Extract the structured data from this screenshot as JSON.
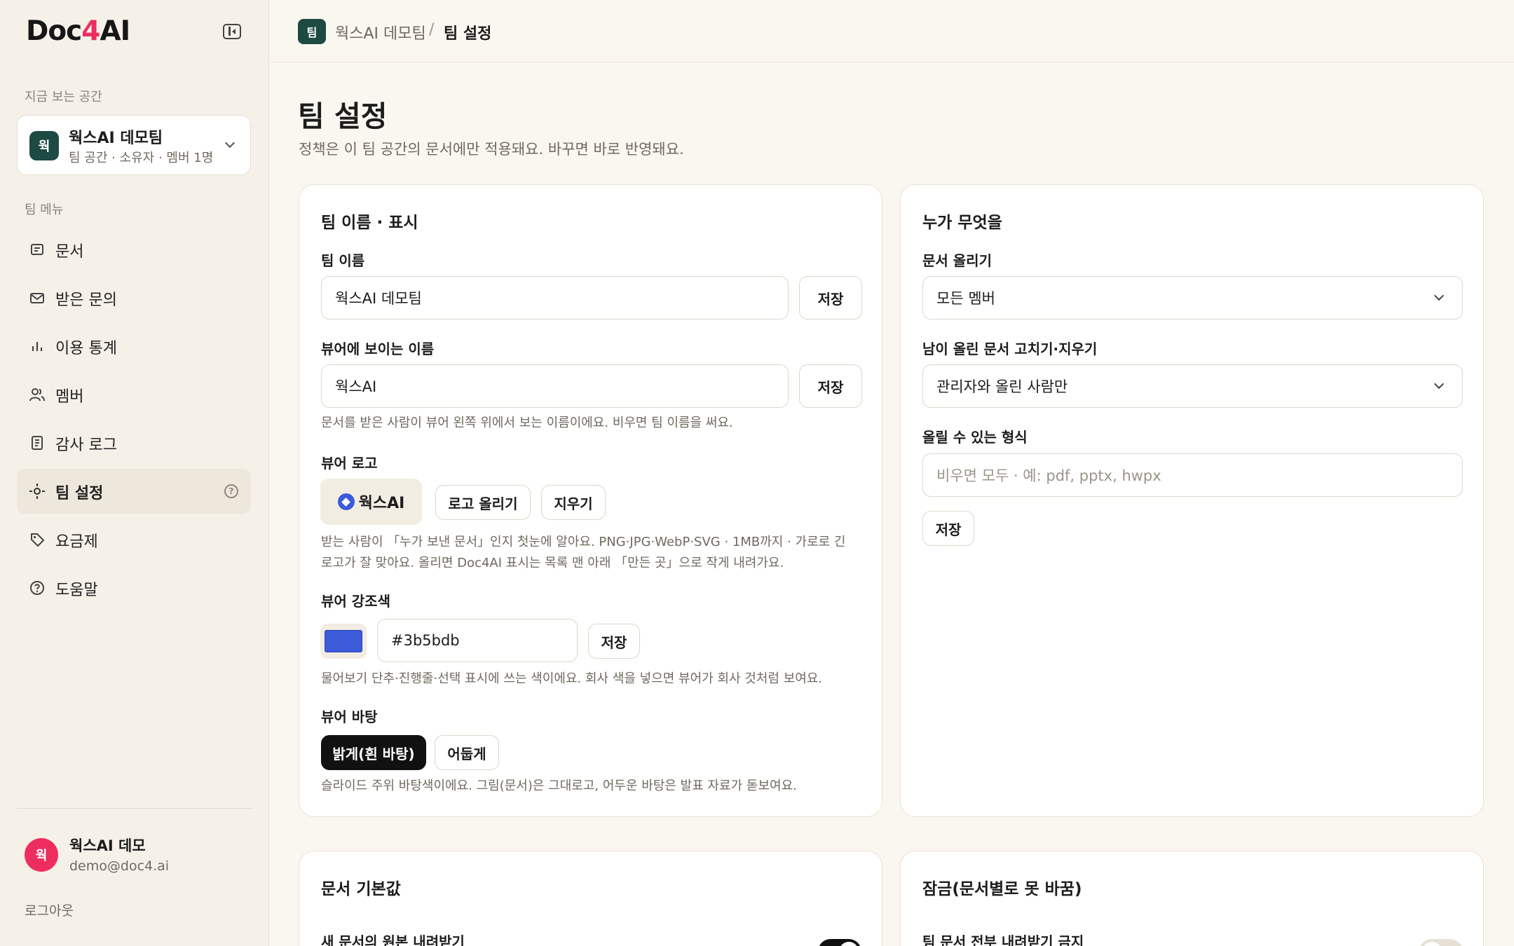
{
  "sidebar": {
    "logo_prefix": "Doc",
    "logo_four": "4",
    "logo_suffix": "AI",
    "current_space_label": "지금 보는 공간",
    "space": {
      "avatar": "웍",
      "name": "웍스AI 데모팀",
      "sub": "팀 공간 · 소유자 · 멤버 1명"
    },
    "team_menu_label": "팀 메뉴",
    "items": [
      {
        "label": "문서",
        "icon": "document-icon"
      },
      {
        "label": "받은 문의",
        "icon": "mail-icon"
      },
      {
        "label": "이용 통계",
        "icon": "bar-chart-icon"
      },
      {
        "label": "멤버",
        "icon": "users-icon"
      },
      {
        "label": "감사 로그",
        "icon": "log-icon"
      },
      {
        "label": "팀 설정",
        "icon": "settings-icon",
        "active": true
      },
      {
        "label": "요금제",
        "icon": "tag-icon"
      },
      {
        "label": "도움말",
        "icon": "help-icon"
      }
    ],
    "user": {
      "avatar": "웍",
      "name": "웍스AI 데모",
      "email": "demo@doc4.ai"
    },
    "logout_label": "로그아웃"
  },
  "breadcrumb": {
    "avatar": "팀",
    "parent": "웍스AI 데모팀",
    "separator": "/",
    "current": "팀 설정"
  },
  "page": {
    "title": "팀 설정",
    "subtitle": "정책은 이 팀 공간의 문서에만 적용돼요. 바꾸면 바로 반영돼요."
  },
  "name_card": {
    "title": "팀 이름 · 표시",
    "team_name_label": "팀 이름",
    "team_name_value": "웍스AI 데모팀",
    "save_label": "저장",
    "viewer_name_label": "뷰어에 보이는 이름",
    "viewer_name_value": "웍스AI",
    "viewer_name_hint": "문서를 받은 사람이 뷰어 왼쪽 위에서 보는 이름이에요. 비우면 팀 이름을 써요.",
    "viewer_logo_label": "뷰어 로고",
    "logo_preview_text": "웍스AI",
    "upload_logo_label": "로고 올리기",
    "delete_logo_label": "지우기",
    "logo_hint_1": "받는 사람이 「누가 보낸 문서」인지 첫눈에 알아요. PNG·JPG·WebP·SVG · 1MB까지 · 가로로 긴",
    "logo_hint_2": "로고가 잘 맞아요. 올리면 Doc4AI 표시는 목록 맨 아래 「만든 곳」으로 작게 내려가요.",
    "accent_label": "뷰어 강조색",
    "accent_value": "#3b5bdb",
    "accent_color": "#3b5bdb",
    "accent_hint": "물어보기 단추·진행줄·선택 표시에 쓰는 색이에요. 회사 색을 넣으면 뷰어가 회사 것처럼 보여요.",
    "background_label": "뷰어 바탕",
    "bg_light_label": "밝게(흰 바탕)",
    "bg_dark_label": "어둡게",
    "bg_hint": "슬라이드 주위 바탕색이에요. 그림(문서)은 그대로고, 어두운 바탕은 발표 자료가 돋보여요."
  },
  "perm_card": {
    "title": "누가 무엇을",
    "upload_label": "문서 올리기",
    "upload_value": "모든 멤버",
    "edit_label": "남이 올린 문서 고치기·지우기",
    "edit_value": "관리자와 올린 사람만",
    "formats_label": "올릴 수 있는 형식",
    "formats_placeholder": "비우면 모두 · 예: pdf, pptx, hwpx",
    "save_label": "저장"
  },
  "defaults_card": {
    "title": "문서 기본값",
    "first_row_label": "새 문서의 원본 내려받기",
    "toggle_on": true
  },
  "lock_card": {
    "title": "잠금(문서별로 못 바꿈)",
    "first_row_label": "팀 문서 전부 내려받기 금지",
    "toggle_on": false
  }
}
